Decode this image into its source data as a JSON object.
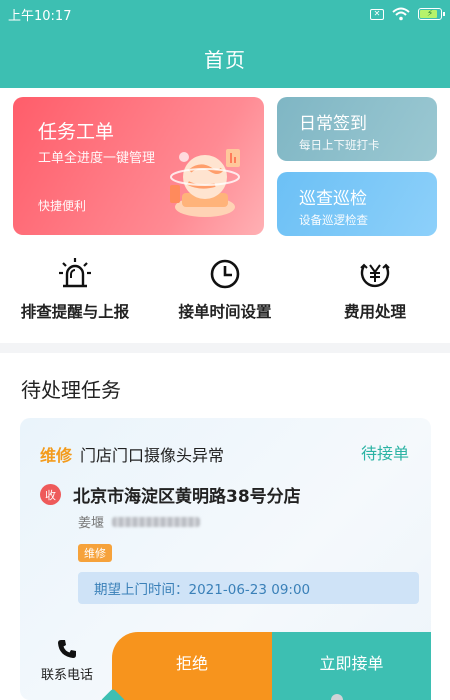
{
  "status_bar": {
    "time": "上午10:17",
    "sim_glyph": "✕",
    "battery_bolt": "⚡",
    "battery_percent": 85
  },
  "header": {
    "title": "首页"
  },
  "cards": {
    "task": {
      "title": "任务工单",
      "subtitle": "工单全进度一键管理",
      "footer": "快捷便利"
    },
    "sign_in": {
      "title": "日常签到",
      "subtitle": "每日上下班打卡"
    },
    "patrol": {
      "title": "巡查巡检",
      "subtitle": "设备巡逻检查"
    }
  },
  "quick_actions": [
    {
      "label": "排查提醒与上报",
      "icon": "alarm-siren-icon"
    },
    {
      "label": "接单时间设置",
      "icon": "clock-icon"
    },
    {
      "label": "费用处理",
      "icon": "yen-coin-icon"
    }
  ],
  "pending": {
    "section_title": "待处理任务",
    "task": {
      "type": "维修",
      "title": "门店门口摄像头异常",
      "status": "待接单",
      "recv_badge": "收",
      "address": "北京市海淀区黄明路38号分店",
      "contact_name": "姜堰",
      "tag": "维修",
      "expected_time": "期望上门时间：2021-06-23 09:00"
    }
  },
  "actions": {
    "contact": "联系电话",
    "reject": "拒绝",
    "accept": "立即接单"
  },
  "colors": {
    "accent": "#3dbfb2",
    "task_card": "#ff6b75",
    "reject": "#f7941d",
    "status": "#2bb3a4"
  }
}
